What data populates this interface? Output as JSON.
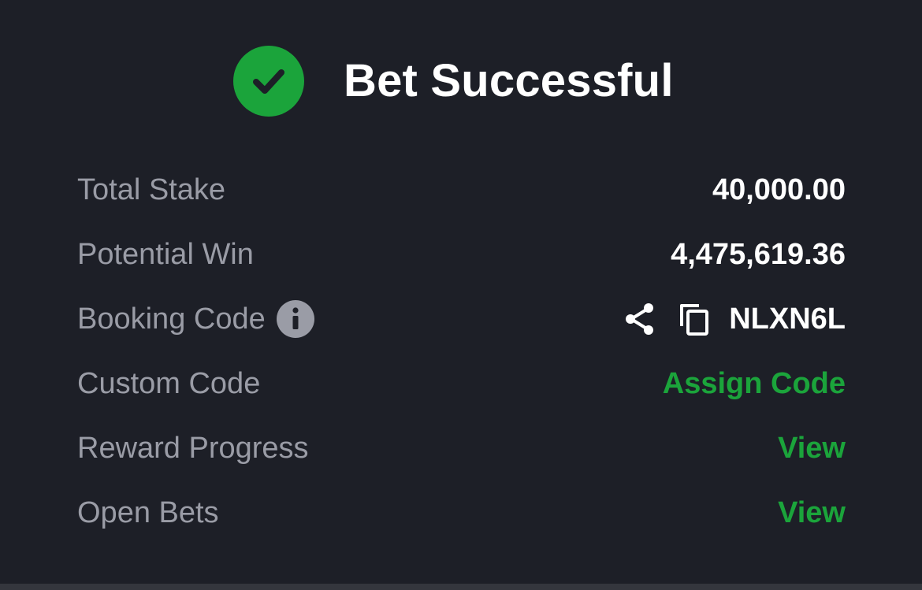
{
  "header": {
    "title": "Bet Successful",
    "icon": "check-circle-icon",
    "icon_color": "#1ba43b"
  },
  "rows": {
    "total_stake": {
      "label": "Total Stake",
      "value": "40,000.00"
    },
    "potential_win": {
      "label": "Potential Win",
      "value": "4,475,619.36"
    },
    "booking_code": {
      "label": "Booking Code",
      "value": "NLXN6L",
      "info_icon": "info-icon",
      "share_icon": "share-icon",
      "copy_icon": "copy-icon"
    },
    "custom_code": {
      "label": "Custom Code",
      "action": "Assign Code"
    },
    "reward_progress": {
      "label": "Reward Progress",
      "action": "View"
    },
    "open_bets": {
      "label": "Open Bets",
      "action": "View"
    }
  },
  "colors": {
    "background": "#1d1f27",
    "label": "#9a9ca6",
    "value": "#ffffff",
    "accent": "#1ba43b"
  }
}
